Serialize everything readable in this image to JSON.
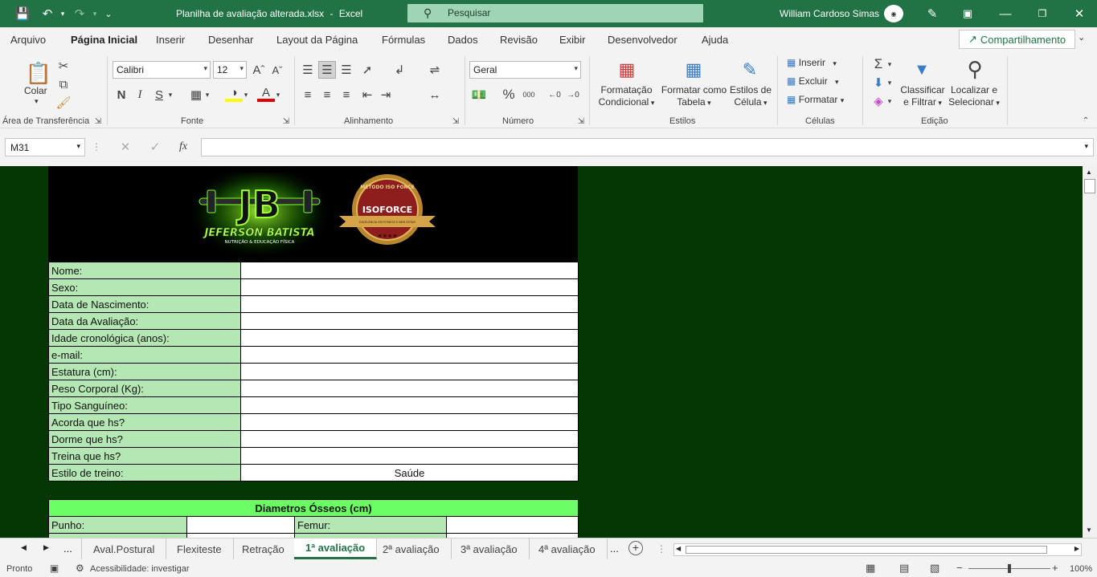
{
  "titlebar": {
    "filename": "Planilha de avaliação alterada.xlsx",
    "separator": "-",
    "app": "Excel",
    "search_placeholder": "Pesquisar",
    "user": "William Cardoso Simas"
  },
  "menu": {
    "tabs": [
      "Arquivo",
      "Página Inicial",
      "Inserir",
      "Desenhar",
      "Layout da Página",
      "Fórmulas",
      "Dados",
      "Revisão",
      "Exibir",
      "Desenvolvedor",
      "Ajuda"
    ],
    "active": "Página Inicial",
    "share": "Compartilhamento"
  },
  "ribbon": {
    "clipboard": {
      "paste": "Colar",
      "label": "Área de Transferência"
    },
    "font": {
      "name": "Calibri",
      "size": "12",
      "bold": "N",
      "italic": "I",
      "underline": "S",
      "label": "Fonte"
    },
    "alignment": {
      "label": "Alinhamento"
    },
    "number": {
      "format": "Geral",
      "percent": "%",
      "thousands": "000",
      "label": "Número"
    },
    "styles": {
      "conditional_1": "Formatação",
      "conditional_2": "Condicional",
      "table_1": "Formatar como",
      "table_2": "Tabela",
      "cell_1": "Estilos de",
      "cell_2": "Célula",
      "label": "Estilos"
    },
    "cells": {
      "insert": "Inserir",
      "delete": "Excluir",
      "format": "Formatar",
      "label": "Células"
    },
    "editing": {
      "sort_1": "Classificar",
      "sort_2": "e Filtrar",
      "find_1": "Localizar e",
      "find_2": "Selecionar",
      "label": "Edição"
    }
  },
  "formula_bar": {
    "name_box": "M31",
    "fx": "fx",
    "formula": ""
  },
  "sheet": {
    "logo_jb": {
      "mark": "JB",
      "name": "JEFERSON BATISTA",
      "tagline": "NUTRIÇÃO & EDUCAÇÃO FÍSICA"
    },
    "logo_iso": {
      "top": "MÉTODO ISO FORCE",
      "name": "ISOFORCE",
      "bottom": "EXCELÊNCIA EM FITNESS E BEM ESTAR"
    },
    "form_rows": [
      {
        "label": "Nome:",
        "value": ""
      },
      {
        "label": "Sexo:",
        "value": ""
      },
      {
        "label": "Data de Nascimento:",
        "value": ""
      },
      {
        "label": "Data da Avaliação:",
        "value": ""
      },
      {
        "label": "Idade cronológica (anos):",
        "value": ""
      },
      {
        "label": "e-mail:",
        "value": ""
      },
      {
        "label": "Estatura (cm):",
        "value": ""
      },
      {
        "label": "Peso Corporal (Kg):",
        "value": ""
      },
      {
        "label": "Tipo Sanguíneo:",
        "value": ""
      },
      {
        "label": "Acorda que hs?",
        "value": ""
      },
      {
        "label": "Dorme que hs?",
        "value": ""
      },
      {
        "label": "Treina que hs?",
        "value": ""
      },
      {
        "label": "Estilo de treino:",
        "value": "Saúde"
      }
    ],
    "diameters": {
      "title": "Diametros Ósseos (cm)",
      "left_label": "Punho:",
      "right_label": "Femur:"
    }
  },
  "sheet_tabs": {
    "tabs": [
      "Aval.Postural",
      "Flexiteste",
      "Retração",
      "1ª avaliação",
      "2ª avaliação",
      "3ª avaliação",
      "4ª avaliação"
    ],
    "active": "1ª avaliação",
    "more": "..."
  },
  "status": {
    "ready": "Pronto",
    "accessibility": "Acessibilidade: investigar",
    "zoom": "100%"
  },
  "colors": {
    "accent": "#217346",
    "sheet_bg": "#033603",
    "label_fill": "#b4e7b4",
    "header_fill": "#6bff63"
  }
}
